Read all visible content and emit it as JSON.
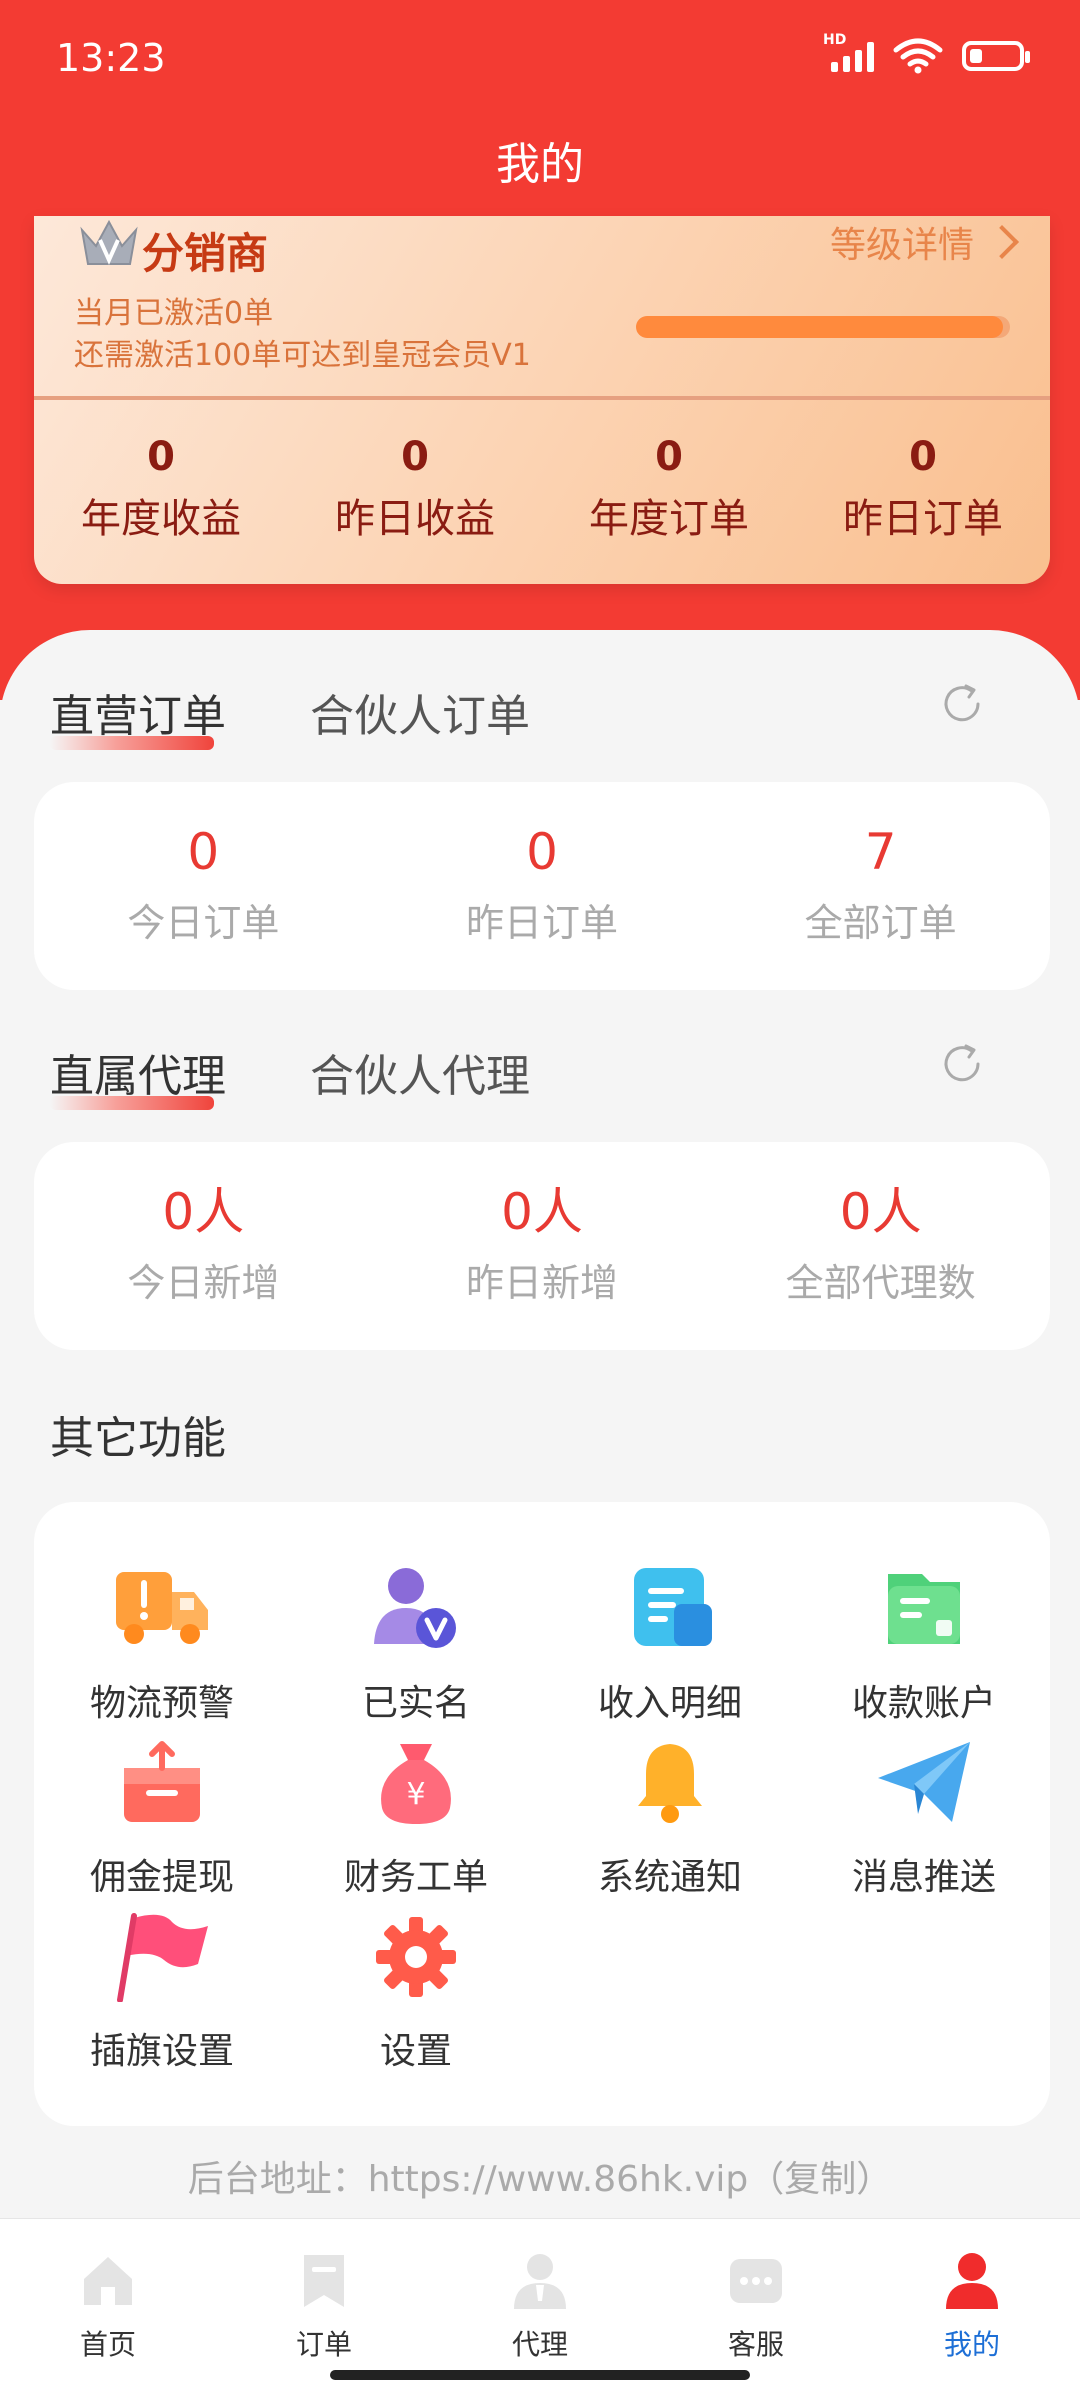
{
  "status_bar": {
    "time": "13:23",
    "network": "HD"
  },
  "header": {
    "title": "我的"
  },
  "member_card": {
    "level_name": "分销商",
    "level_detail_label": "等级详情",
    "activated_text": "当月已激活0单",
    "upgrade_hint": "还需激活100单可达到皇冠会员V1",
    "progress_fraction": 0.98,
    "stats": [
      {
        "value": "0",
        "label": "年度收益"
      },
      {
        "value": "0",
        "label": "昨日收益"
      },
      {
        "value": "0",
        "label": "年度订单"
      },
      {
        "value": "0",
        "label": "昨日订单"
      }
    ]
  },
  "orders": {
    "tabs": [
      {
        "label": "直营订单"
      },
      {
        "label": "合伙人订单"
      }
    ],
    "stats": [
      {
        "value": "0",
        "label": "今日订单"
      },
      {
        "value": "0",
        "label": "昨日订单"
      },
      {
        "value": "7",
        "label": "全部订单"
      }
    ]
  },
  "agents": {
    "tabs": [
      {
        "label": "直属代理"
      },
      {
        "label": "合伙人代理"
      }
    ],
    "stats": [
      {
        "value": "0人",
        "label": "今日新增"
      },
      {
        "value": "0人",
        "label": "昨日新增"
      },
      {
        "value": "0人",
        "label": "全部代理数"
      }
    ]
  },
  "other_functions": {
    "title": "其它功能",
    "items": [
      {
        "label": "物流预警",
        "icon": "truck-warning-icon"
      },
      {
        "label": "已实名",
        "icon": "verified-user-icon"
      },
      {
        "label": "收入明细",
        "icon": "income-doc-icon"
      },
      {
        "label": "收款账户",
        "icon": "wallet-icon"
      },
      {
        "label": "佣金提现",
        "icon": "withdraw-box-icon"
      },
      {
        "label": "财务工单",
        "icon": "money-bag-icon"
      },
      {
        "label": "系统通知",
        "icon": "bell-icon"
      },
      {
        "label": "消息推送",
        "icon": "paper-plane-icon"
      },
      {
        "label": "插旗设置",
        "icon": "flag-icon"
      },
      {
        "label": "设置",
        "icon": "gear-icon"
      }
    ]
  },
  "backend_address": "后台地址：https://www.86hk.vip（复制）",
  "bottom_nav": [
    {
      "label": "首页",
      "icon": "home-icon"
    },
    {
      "label": "订单",
      "icon": "bookmark-icon"
    },
    {
      "label": "代理",
      "icon": "agent-icon"
    },
    {
      "label": "客服",
      "icon": "chat-icon"
    },
    {
      "label": "我的",
      "icon": "profile-icon",
      "active": true
    }
  ],
  "colors": {
    "brand_red": "#f33b33",
    "value_red": "#e83a33",
    "active_blue": "#1d6fd6"
  }
}
